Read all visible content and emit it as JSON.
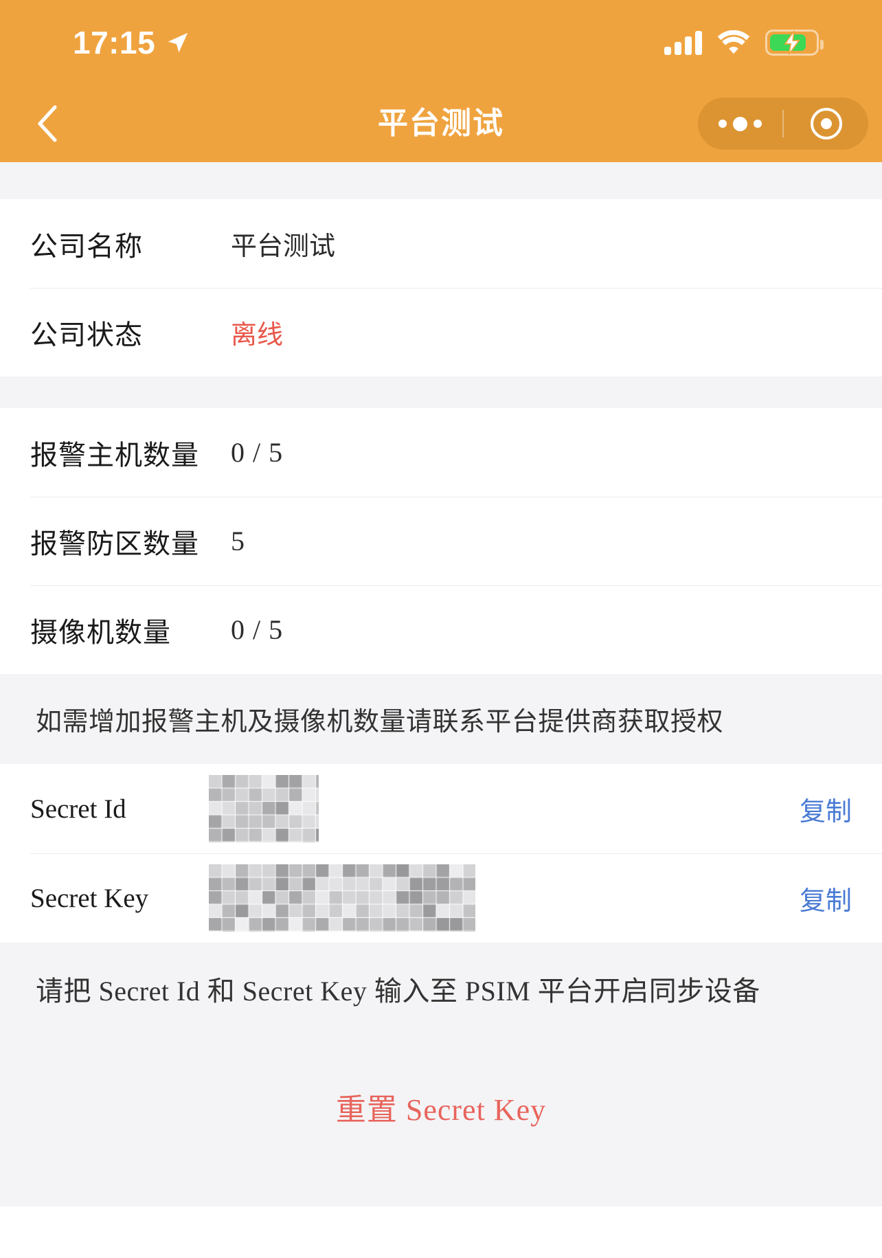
{
  "status_bar": {
    "time": "17:15",
    "location_icon": "location-arrow-icon",
    "signal_icon": "cellular-signal-icon",
    "wifi_icon": "wifi-icon",
    "battery_icon": "battery-charging-icon",
    "battery_level_percent": 72,
    "charging": true,
    "background_color": "#efa33f"
  },
  "nav": {
    "back_icon": "chevron-left-icon",
    "title": "平台测试",
    "capsule": {
      "more_icon": "more-dots-icon",
      "close_icon": "target-circle-icon"
    }
  },
  "info_card": {
    "rows": [
      {
        "label": "公司名称",
        "value": "平台测试",
        "accent": false
      },
      {
        "label": "公司状态",
        "value": "离线",
        "accent": true
      }
    ]
  },
  "counts_card": {
    "rows": [
      {
        "label": "报警主机数量",
        "value": "0 / 5"
      },
      {
        "label": "报警防区数量",
        "value": "5"
      },
      {
        "label": "摄像机数量",
        "value": "0 / 5"
      }
    ]
  },
  "notice_authorization": "如需增加报警主机及摄像机数量请联系平台提供商获取授权",
  "secret_card": {
    "rows": [
      {
        "label": "Secret Id",
        "value": "",
        "value_masked": true,
        "copy_label": "复制"
      },
      {
        "label": "Secret Key",
        "value": "",
        "value_masked": true,
        "copy_label": "复制"
      }
    ]
  },
  "notice_psim": "请把 Secret Id 和 Secret Key 输入至 PSIM 平台开启同步设备",
  "reset_button_label": "重置 Secret Key",
  "colors": {
    "brand": "#efa33f",
    "danger": "#e8564a",
    "link": "#4a7bd4",
    "reset": "#e8645c",
    "page_bg": "#f4f4f6",
    "card_bg": "#ffffff"
  }
}
